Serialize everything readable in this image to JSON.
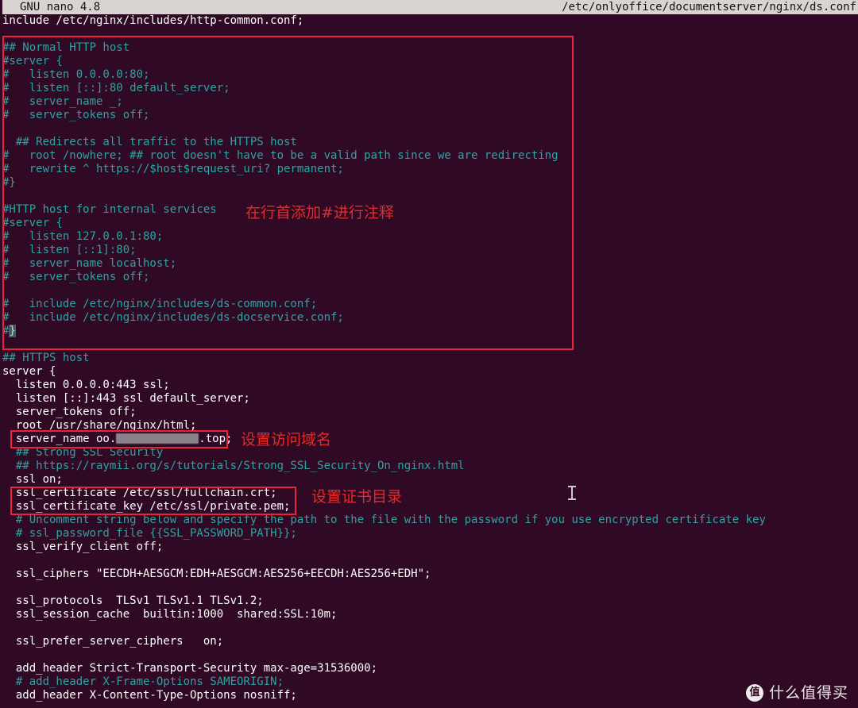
{
  "titlebar": {
    "app": "GNU nano 4.8",
    "filepath": "/etc/onlyoffice/documentserver/nginx/ds.conf"
  },
  "editor": {
    "lines": [
      {
        "text": "include /etc/nginx/includes/http-common.conf;",
        "type": "code"
      },
      {
        "text": "",
        "type": "blank"
      },
      {
        "text": "## Normal HTTP host",
        "type": "comment"
      },
      {
        "text": "#server {",
        "type": "comment"
      },
      {
        "text": "#   listen 0.0.0.0:80;",
        "type": "comment"
      },
      {
        "text": "#   listen [::]:80 default_server;",
        "type": "comment"
      },
      {
        "text": "#   server_name _;",
        "type": "comment"
      },
      {
        "text": "#   server_tokens off;",
        "type": "comment"
      },
      {
        "text": "",
        "type": "blank"
      },
      {
        "text": "  ## Redirects all traffic to the HTTPS host",
        "type": "comment"
      },
      {
        "text": "#   root /nowhere; ## root doesn't have to be a valid path since we are redirecting",
        "type": "comment"
      },
      {
        "text": "#   rewrite ^ https://$host$request_uri? permanent;",
        "type": "comment"
      },
      {
        "text": "#}",
        "type": "comment"
      },
      {
        "text": "",
        "type": "blank"
      },
      {
        "text": "#HTTP host for internal services",
        "type": "comment"
      },
      {
        "text": "#server {",
        "type": "comment"
      },
      {
        "text": "#   listen 127.0.0.1:80;",
        "type": "comment"
      },
      {
        "text": "#   listen [::1]:80;",
        "type": "comment"
      },
      {
        "text": "#   server_name localhost;",
        "type": "comment"
      },
      {
        "text": "#   server_tokens off;",
        "type": "comment"
      },
      {
        "text": "",
        "type": "blank"
      },
      {
        "text": "#   include /etc/nginx/includes/ds-common.conf;",
        "type": "comment"
      },
      {
        "text": "#   include /etc/nginx/includes/ds-docservice.conf;",
        "type": "comment"
      },
      {
        "text": "#}",
        "type": "comment-cursor",
        "cursor_char": "}"
      },
      {
        "text": "",
        "type": "blank"
      },
      {
        "text": "## HTTPS host",
        "type": "comment"
      },
      {
        "text": "server {",
        "type": "code"
      },
      {
        "text": "  listen 0.0.0.0:443 ssl;",
        "type": "code"
      },
      {
        "text": "  listen [::]:443 ssl default_server;",
        "type": "code"
      },
      {
        "text": "  server_tokens off;",
        "type": "code"
      },
      {
        "text": "  root /usr/share/nginx/html;",
        "type": "code"
      },
      {
        "text": "  server_name oo.",
        "type": "code-redacted",
        "suffix": ".top;"
      },
      {
        "text": "  ## Strong SSL Security",
        "type": "comment"
      },
      {
        "text": "  ## https://raymii.org/s/tutorials/Strong_SSL_Security_On_nginx.html",
        "type": "comment"
      },
      {
        "text": "  ssl on;",
        "type": "code"
      },
      {
        "text": "  ssl_certificate /etc/ssl/fullchain.crt;",
        "type": "code"
      },
      {
        "text": "  ssl_certificate_key /etc/ssl/private.pem;",
        "type": "code"
      },
      {
        "text": "  # Uncomment string below and specify the path to the file with the password if you use encrypted certificate key",
        "type": "comment"
      },
      {
        "text": "  # ssl_password_file {{SSL_PASSWORD_PATH}};",
        "type": "comment"
      },
      {
        "text": "  ssl_verify_client off;",
        "type": "code"
      },
      {
        "text": "",
        "type": "blank"
      },
      {
        "text": "  ssl_ciphers \"EECDH+AESGCM:EDH+AESGCM:AES256+EECDH:AES256+EDH\";",
        "type": "code"
      },
      {
        "text": "",
        "type": "blank"
      },
      {
        "text": "  ssl_protocols  TLSv1 TLSv1.1 TLSv1.2;",
        "type": "code"
      },
      {
        "text": "  ssl_session_cache  builtin:1000  shared:SSL:10m;",
        "type": "code"
      },
      {
        "text": "",
        "type": "blank"
      },
      {
        "text": "  ssl_prefer_server_ciphers   on;",
        "type": "code"
      },
      {
        "text": "",
        "type": "blank"
      },
      {
        "text": "  add_header Strict-Transport-Security max-age=31536000;",
        "type": "code"
      },
      {
        "text": "  # add_header X-Frame-Options SAMEORIGIN;",
        "type": "comment"
      },
      {
        "text": "  add_header X-Content-Type-Options nosniff;",
        "type": "code"
      }
    ]
  },
  "annotations": [
    {
      "id": "comment-hint",
      "text": "在行首添加#进行注释"
    },
    {
      "id": "domain-hint",
      "text": "设置访问域名"
    },
    {
      "id": "certdir-hint",
      "text": "设置证书目录"
    }
  ],
  "watermark": {
    "logo_char": "值",
    "text": "什么值得买"
  },
  "colors": {
    "terminal_background": "#300a24",
    "code_text": "#ffffff",
    "comment_text": "#2ea3a3",
    "annotation_red": "#e22b2b",
    "box_red": "#e8243c",
    "titlebar_background": "#d8d4d0"
  }
}
